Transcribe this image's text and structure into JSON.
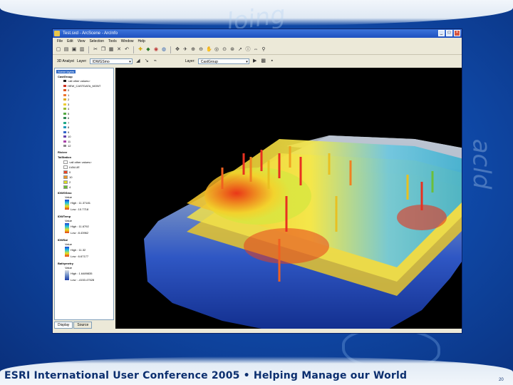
{
  "slide": {
    "watermark_1": "loing",
    "watermark_2": "acld",
    "footer_title": "ESRI International User Conference 2005 • Helping Manage our World",
    "page_number": "20"
  },
  "window": {
    "title": "Test.sxd - ArcScene - ArcInfo",
    "controls": [
      "_",
      "□",
      "×"
    ],
    "menu": [
      "File",
      "Edit",
      "View",
      "Selection",
      "Tools",
      "Window",
      "Help"
    ],
    "toolbar_icons": [
      "new-icon",
      "open-icon",
      "save-icon",
      "print-icon",
      "cut-icon",
      "copy-icon",
      "paste-icon",
      "delete-icon",
      "undo-icon",
      "add-data-icon",
      "navigate-icon",
      "fly-icon",
      "zoom-in-icon",
      "zoom-out-icon",
      "pan-icon",
      "full-extent-icon",
      "select-icon",
      "identify-icon",
      "measure-icon"
    ],
    "analyst_label": "3D Analyst",
    "layer_label": "Layer:",
    "layer1_value": "IDWGSmo",
    "layer2_label": "Layer:",
    "layer2_value": "CastGroup",
    "tabs": [
      "Display",
      "Source"
    ]
  },
  "toc": {
    "root": "Scene layers",
    "layers": [
      {
        "name": "CastGroup",
        "items": [
          "<all other values>",
          "HEW_CASTDATA_MONT",
          "0",
          "1",
          "2",
          "3",
          "4",
          "5",
          "6",
          "7",
          "8",
          "9",
          "10",
          "11",
          "12"
        ]
      },
      {
        "name": "Riviere"
      },
      {
        "name": "TalStation",
        "items": [
          "<all other values>",
          "LVALUE",
          "0",
          "10",
          "2",
          "4"
        ]
      },
      {
        "name": "IDWGSmo",
        "value_label": "Value",
        "high": "High : 11.37181",
        "low": "Low : 10.7718"
      },
      {
        "name": "IDWTemp",
        "value_label": "Value",
        "high": "High : 11.6792",
        "low": "Low : 8.43962"
      },
      {
        "name": "IDWSal",
        "value_label": "Value",
        "high": "High : 11.32",
        "low": "Low : 6.67177"
      },
      {
        "name": "Bathymetry",
        "value_label": "Value",
        "high": "High : 1.6489835",
        "low": "Low : -4153.47528"
      }
    ],
    "castgroup_colors": [
      "#222222",
      "#cc3322",
      "#dd5522",
      "#ee7733",
      "#ddaa22",
      "#eecc33",
      "#99bb33",
      "#55aa44",
      "#338855",
      "#22aa88",
      "#2299bb",
      "#3366cc",
      "#6644aa",
      "#aa44aa"
    ],
    "station_colors": [
      "#ffffff",
      "#ee4422",
      "#ee9922",
      "#dddd22",
      "#66bb33"
    ]
  }
}
